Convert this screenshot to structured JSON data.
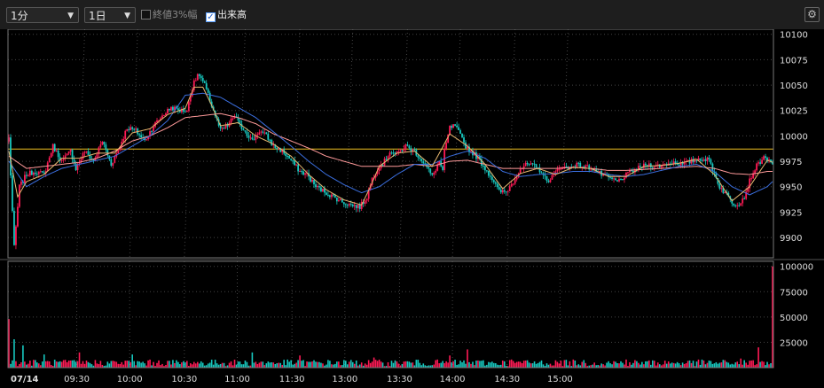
{
  "toolbar": {
    "interval_select": "1分",
    "period_select": "1日",
    "checkbox_close3": "終値3%幅",
    "checkbox_volume": "出来高"
  },
  "icons": {
    "arrow": "dropdown-arrow-icon",
    "settings": "gear-icon"
  },
  "colors": {
    "up": "#ff1a55",
    "down": "#17c9c0",
    "ma_short": "#e8b870",
    "ma_mid": "#3b6fe0",
    "ma_long": "#ff9a9a",
    "prev_close": "#f0c020"
  },
  "chart_data": [
    {
      "type": "candlestick",
      "title": "",
      "date_label": "07/14",
      "x_ticks": [
        "09:30",
        "10:00",
        "10:30",
        "11:00",
        "11:30",
        "13:00",
        "13:30",
        "14:00",
        "14:30",
        "15:00"
      ],
      "y_ticks": [
        9900,
        9925,
        9950,
        9975,
        10000,
        10025,
        10050,
        10075,
        10100
      ],
      "ylim": [
        9880,
        10105
      ],
      "reference_line": 9987,
      "grid": true,
      "series": {
        "close": [
          [
            0,
            9998
          ],
          [
            3,
            9890
          ],
          [
            6,
            9950
          ],
          [
            10,
            9962
          ],
          [
            15,
            9965
          ],
          [
            20,
            9962
          ],
          [
            25,
            9990
          ],
          [
            30,
            9975
          ],
          [
            35,
            9985
          ],
          [
            38,
            9968
          ],
          [
            43,
            9985
          ],
          [
            48,
            9975
          ],
          [
            53,
            9995
          ],
          [
            58,
            9972
          ],
          [
            63,
            9990
          ],
          [
            67,
            10008
          ],
          [
            72,
            10005
          ],
          [
            77,
            9995
          ],
          [
            82,
            10010
          ],
          [
            87,
            10020
          ],
          [
            92,
            10028
          ],
          [
            97,
            10025
          ],
          [
            101,
            10025
          ],
          [
            105,
            10055
          ],
          [
            108,
            10060
          ],
          [
            111,
            10050
          ],
          [
            114,
            10035
          ],
          [
            117,
            10020
          ],
          [
            120,
            10005
          ],
          [
            124,
            10010
          ],
          [
            128,
            10020
          ],
          [
            131,
            10010
          ],
          [
            134,
            10005
          ],
          [
            138,
            9995
          ],
          [
            142,
            10005
          ],
          [
            146,
            10000
          ],
          [
            150,
            9990
          ],
          [
            155,
            9985
          ],
          [
            160,
            9976
          ],
          [
            165,
            9965
          ],
          [
            169,
            9962
          ],
          [
            174,
            9950
          ],
          [
            179,
            9945
          ],
          [
            184,
            9940
          ],
          [
            189,
            9935
          ],
          [
            194,
            9932
          ],
          [
            199,
            9930
          ],
          [
            203,
            9940
          ],
          [
            206,
            9958
          ],
          [
            209,
            9968
          ],
          [
            213,
            9975
          ],
          [
            216,
            9985
          ],
          [
            220,
            9982
          ],
          [
            225,
            9990
          ],
          [
            230,
            9985
          ],
          [
            236,
            9972
          ],
          [
            240,
            9960
          ],
          [
            244,
            9975
          ],
          [
            246,
            9965
          ],
          [
            247,
            9985
          ],
          [
            250,
            10008
          ],
          [
            253,
            10010
          ],
          [
            256,
            10000
          ],
          [
            259,
            9990
          ],
          [
            262,
            9985
          ],
          [
            266,
            9978
          ],
          [
            270,
            9968
          ],
          [
            274,
            9958
          ],
          [
            278,
            9945
          ],
          [
            282,
            9945
          ],
          [
            286,
            9955
          ],
          [
            290,
            9968
          ],
          [
            294,
            9972
          ],
          [
            298,
            9970
          ],
          [
            302,
            9965
          ],
          [
            305,
            9955
          ],
          [
            309,
            9962
          ],
          [
            313,
            9970
          ],
          [
            317,
            9968
          ],
          [
            321,
            9972
          ],
          [
            326,
            9970
          ],
          [
            331,
            9968
          ],
          [
            336,
            9962
          ],
          [
            341,
            9958
          ],
          [
            345,
            9955
          ],
          [
            349,
            9960
          ],
          [
            353,
            9965
          ],
          [
            357,
            9968
          ],
          [
            362,
            9972
          ],
          [
            367,
            9970
          ],
          [
            372,
            9972
          ],
          [
            377,
            9974
          ],
          [
            382,
            9972
          ],
          [
            387,
            9975
          ],
          [
            392,
            9978
          ],
          [
            397,
            9976
          ],
          [
            403,
            9950
          ],
          [
            407,
            9942
          ],
          [
            411,
            9933
          ],
          [
            414,
            9934
          ],
          [
            417,
            9940
          ],
          [
            420,
            9956
          ],
          [
            423,
            9968
          ],
          [
            426,
            9975
          ],
          [
            429,
            9980
          ],
          [
            432,
            9972
          ]
        ],
        "ma_short": [
          [
            0,
            9985
          ],
          [
            5,
            9940
          ],
          [
            10,
            9955
          ],
          [
            20,
            9962
          ],
          [
            30,
            9978
          ],
          [
            40,
            9978
          ],
          [
            50,
            9983
          ],
          [
            60,
            9983
          ],
          [
            70,
            10003
          ],
          [
            80,
            10007
          ],
          [
            90,
            10021
          ],
          [
            100,
            10027
          ],
          [
            105,
            10048
          ],
          [
            110,
            10048
          ],
          [
            115,
            10030
          ],
          [
            120,
            10010
          ],
          [
            130,
            10013
          ],
          [
            140,
            10000
          ],
          [
            150,
            9992
          ],
          [
            160,
            9980
          ],
          [
            170,
            9962
          ],
          [
            180,
            9947
          ],
          [
            190,
            9937
          ],
          [
            200,
            9932
          ],
          [
            205,
            9950
          ],
          [
            210,
            9970
          ],
          [
            220,
            9983
          ],
          [
            230,
            9985
          ],
          [
            240,
            9970
          ],
          [
            250,
            10002
          ],
          [
            260,
            9990
          ],
          [
            270,
            9972
          ],
          [
            280,
            9948
          ],
          [
            290,
            9963
          ],
          [
            300,
            9968
          ],
          [
            310,
            9962
          ],
          [
            320,
            9969
          ],
          [
            330,
            9968
          ],
          [
            340,
            9960
          ],
          [
            350,
            9960
          ],
          [
            360,
            9970
          ],
          [
            370,
            9971
          ],
          [
            380,
            9973
          ],
          [
            390,
            9977
          ],
          [
            400,
            9962
          ],
          [
            410,
            9936
          ],
          [
            420,
            9950
          ],
          [
            430,
            9976
          ],
          [
            433,
            9974
          ]
        ],
        "ma_mid": [
          [
            0,
            9975
          ],
          [
            10,
            9950
          ],
          [
            20,
            9960
          ],
          [
            30,
            9968
          ],
          [
            40,
            9972
          ],
          [
            50,
            9976
          ],
          [
            60,
            9980
          ],
          [
            70,
            9990
          ],
          [
            80,
            10000
          ],
          [
            90,
            10015
          ],
          [
            100,
            10040
          ],
          [
            110,
            10042
          ],
          [
            120,
            10038
          ],
          [
            130,
            10028
          ],
          [
            140,
            10018
          ],
          [
            150,
            10004
          ],
          [
            160,
            9990
          ],
          [
            170,
            9975
          ],
          [
            180,
            9962
          ],
          [
            190,
            9952
          ],
          [
            200,
            9944
          ],
          [
            210,
            9950
          ],
          [
            220,
            9962
          ],
          [
            230,
            9972
          ],
          [
            240,
            9972
          ],
          [
            250,
            9980
          ],
          [
            260,
            9985
          ],
          [
            270,
            9978
          ],
          [
            280,
            9965
          ],
          [
            290,
            9960
          ],
          [
            300,
            9962
          ],
          [
            310,
            9963
          ],
          [
            320,
            9965
          ],
          [
            330,
            9965
          ],
          [
            340,
            9962
          ],
          [
            350,
            9960
          ],
          [
            360,
            9962
          ],
          [
            370,
            9966
          ],
          [
            380,
            9970
          ],
          [
            390,
            9972
          ],
          [
            400,
            9965
          ],
          [
            410,
            9950
          ],
          [
            420,
            9942
          ],
          [
            430,
            9950
          ],
          [
            433,
            9955
          ]
        ],
        "ma_long": [
          [
            0,
            9980
          ],
          [
            10,
            9968
          ],
          [
            20,
            9970
          ],
          [
            30,
            9972
          ],
          [
            40,
            9974
          ],
          [
            50,
            9978
          ],
          [
            60,
            9985
          ],
          [
            70,
            9995
          ],
          [
            80,
            10000
          ],
          [
            90,
            10008
          ],
          [
            100,
            10018
          ],
          [
            110,
            10020
          ],
          [
            120,
            10022
          ],
          [
            130,
            10018
          ],
          [
            140,
            10012
          ],
          [
            150,
            10002
          ],
          [
            160,
            9995
          ],
          [
            170,
            9988
          ],
          [
            180,
            9980
          ],
          [
            190,
            9975
          ],
          [
            200,
            9970
          ],
          [
            210,
            9970
          ],
          [
            220,
            9970
          ],
          [
            230,
            9972
          ],
          [
            240,
            9970
          ],
          [
            250,
            9975
          ],
          [
            260,
            9976
          ],
          [
            270,
            9972
          ],
          [
            280,
            9968
          ],
          [
            290,
            9968
          ],
          [
            300,
            9968
          ],
          [
            310,
            9968
          ],
          [
            320,
            9969
          ],
          [
            330,
            9968
          ],
          [
            340,
            9966
          ],
          [
            350,
            9966
          ],
          [
            360,
            9967
          ],
          [
            370,
            9968
          ],
          [
            380,
            9969
          ],
          [
            390,
            9970
          ],
          [
            400,
            9968
          ],
          [
            410,
            9963
          ],
          [
            420,
            9962
          ],
          [
            430,
            9965
          ],
          [
            433,
            9965
          ]
        ]
      }
    },
    {
      "type": "bar",
      "title": "volume",
      "y_ticks": [
        25000,
        50000,
        75000,
        100000
      ],
      "ylim": [
        0,
        105000
      ],
      "spikes": [
        [
          0,
          48000
        ],
        [
          3,
          28000
        ],
        [
          8,
          22000
        ],
        [
          20,
          13000
        ],
        [
          40,
          15000
        ],
        [
          70,
          13000
        ],
        [
          138,
          15000
        ],
        [
          165,
          12000
        ],
        [
          207,
          10000
        ],
        [
          250,
          12000
        ],
        [
          260,
          18000
        ],
        [
          285,
          8000
        ],
        [
          321,
          7000
        ],
        [
          350,
          8000
        ],
        [
          390,
          6000
        ],
        [
          415,
          9000
        ],
        [
          425,
          20000
        ],
        [
          433,
          100000
        ]
      ]
    }
  ]
}
